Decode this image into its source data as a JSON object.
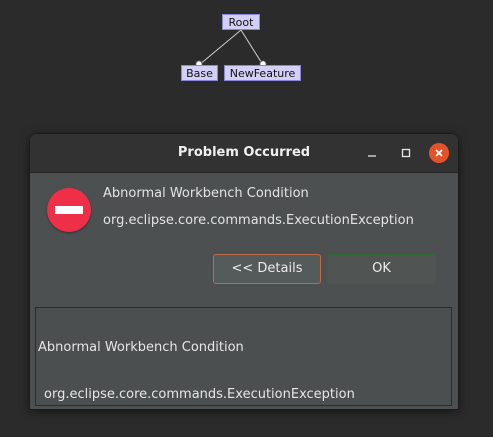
{
  "feature_model": {
    "root": "Root",
    "children": [
      "Base",
      "NewFeature"
    ]
  },
  "dialog": {
    "title": "Problem Occurred",
    "window_buttons": {
      "minimize_icon": "minimize-icon",
      "maximize_icon": "maximize-icon",
      "close_icon": "close-icon"
    },
    "message_title": "Abnormal Workbench Condition",
    "message_detail": "org.eclipse.core.commands.ExecutionException",
    "details_button": "<< Details",
    "ok_button": "OK",
    "details_text": {
      "line1": "Abnormal Workbench Condition",
      "line2": "org.eclipse.core.commands.ExecutionException"
    }
  },
  "colors": {
    "error_icon": "#ef2f48",
    "close_button": "#e3532b",
    "node_fill": "#d2d0f7",
    "node_border": "#8a86d8"
  }
}
